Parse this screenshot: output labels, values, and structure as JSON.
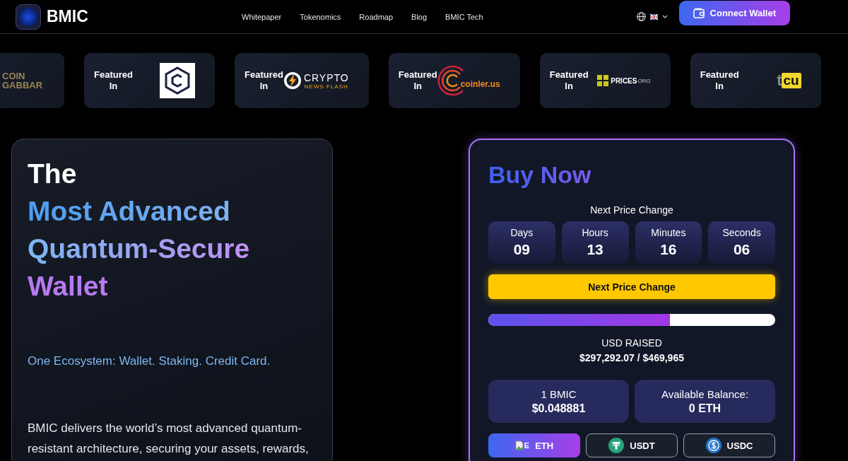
{
  "header": {
    "brand": "BMIC",
    "nav": [
      "Whitepaper",
      "Tokenomics",
      "Roadmap",
      "Blog",
      "BMIC Tech"
    ],
    "connect_button": "Connect Wallet"
  },
  "featured": [
    {
      "kind": "coingabbar",
      "logo_text": [
        "COIN",
        "GABBAR"
      ]
    },
    {
      "kind": "hexagon",
      "label": [
        "Featured",
        "In"
      ]
    },
    {
      "kind": "cryptonewsflash",
      "label": [
        "Featured",
        "In"
      ],
      "logo_text": [
        "CRYPTO",
        "NEWS FLASH"
      ]
    },
    {
      "kind": "coinler",
      "label": [
        "Featured",
        "In"
      ],
      "logo_text": [
        "coinler.us"
      ]
    },
    {
      "kind": "prices",
      "label": [
        "Featured",
        "In"
      ],
      "logo_text": [
        "PRICES",
        "ORG"
      ]
    },
    {
      "kind": "tcu",
      "label": [
        "Featured",
        "In"
      ],
      "logo_text": [
        "t",
        "cu"
      ]
    }
  ],
  "hero": {
    "title_lines": [
      "The",
      "Most Advanced",
      "Quantum-Secure",
      "Wallet"
    ],
    "tagline": "One Ecosystem: Wallet. Staking. Credit Card.",
    "body": "BMIC delivers the world’s most advanced quantum-resistant architecture, securing your assets, rewards,"
  },
  "buy": {
    "title": "Buy Now",
    "countdown_label": "Next Price Change",
    "countdown": [
      {
        "unit": "Days",
        "value": "09"
      },
      {
        "unit": "Hours",
        "value": "13"
      },
      {
        "unit": "Minutes",
        "value": "16"
      },
      {
        "unit": "Seconds",
        "value": "06"
      }
    ],
    "price_button": "Next Price Change",
    "progress": {
      "level": 0.633
    },
    "raised_label": "USD RAISED",
    "raised_value": "$297,292.07 / $469,965",
    "info": [
      {
        "label": "1 BMIC",
        "value": "$0.048881"
      },
      {
        "label": "Available Balance:",
        "value": "0 ETH"
      }
    ],
    "currencies": [
      {
        "kind": "eth",
        "label": "ETH",
        "icon_alt": "E",
        "selected": true
      },
      {
        "kind": "usdt",
        "label": "USDT",
        "selected": false
      },
      {
        "kind": "usdc",
        "label": "USDC",
        "selected": false
      }
    ]
  }
}
